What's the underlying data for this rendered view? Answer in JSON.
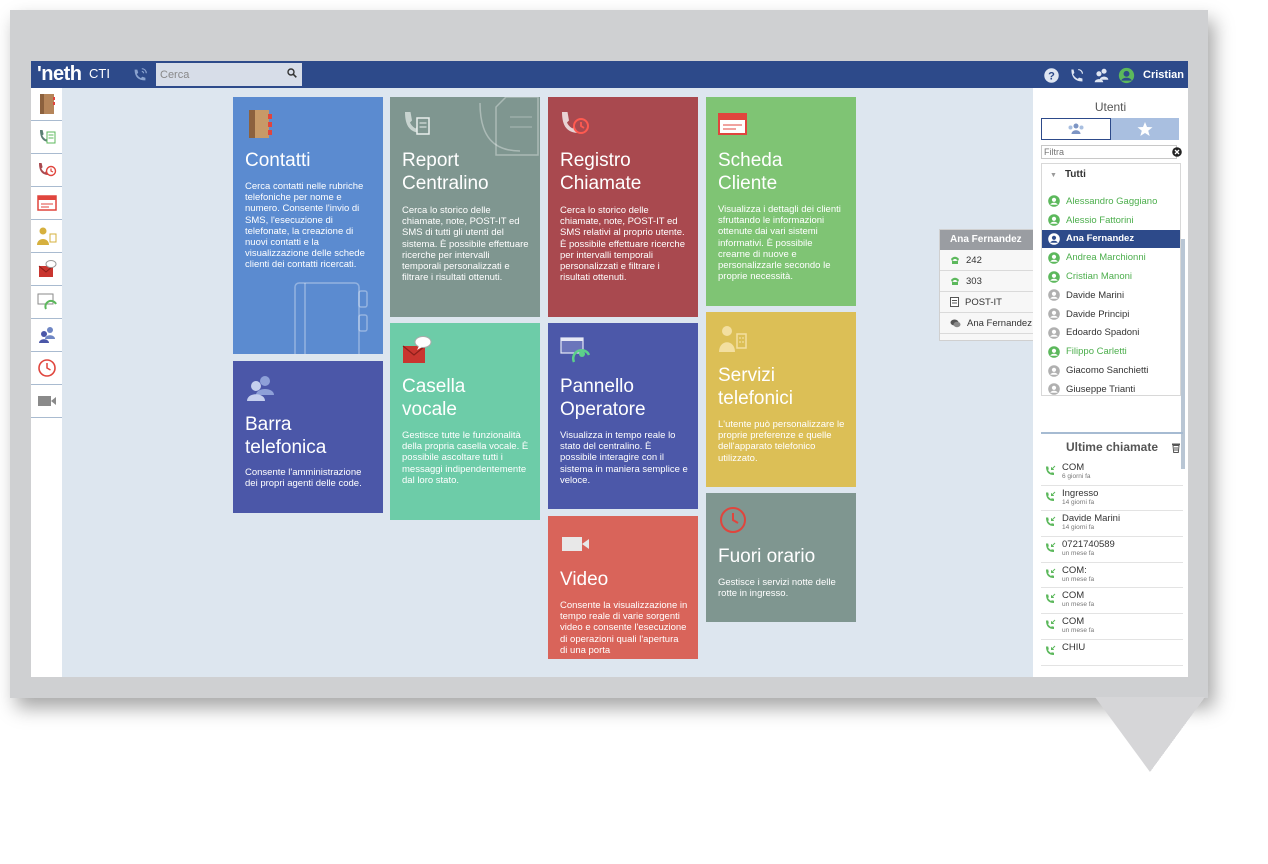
{
  "brand": {
    "logo": "'neth",
    "product": "CTI"
  },
  "search": {
    "placeholder": "Cerca"
  },
  "user": {
    "name": "Cristian"
  },
  "tiles": [
    {
      "key": "contatti",
      "title": "Contatti",
      "desc": "Cerca contatti nelle rubriche telefoniche per nome e numero. Consente l'invio di SMS, l'esecuzione di telefonate, la creazione di nuovi contatti e la visualizzazione delle schede clienti dei contatti ricercati.",
      "color": "#5b8bd0"
    },
    {
      "key": "barra",
      "title": "Barra telefonica",
      "desc": "Consente l'amministrazione dei propri agenti delle code.",
      "color": "#4b57a8"
    },
    {
      "key": "report",
      "title": "Report Centralino",
      "desc": "Cerca lo storico delle chiamate, note, POST-IT ed SMS di tutti gli utenti del sistema. È possibile effettuare ricerche per intervalli temporali personalizzati e filtrare i risultati ottenuti.",
      "color": "#7f9690"
    },
    {
      "key": "casella",
      "title": "Casella vocale",
      "desc": "Gestisce tutte le funzionalità della propria casella vocale. È possibile ascoltare tutti i messaggi indipendentemente dal loro stato.",
      "color": "#6dcca8"
    },
    {
      "key": "registro",
      "title": "Registro Chiamate",
      "desc": "Cerca lo storico delle chiamate, note, POST-IT ed SMS relativi al proprio utente. È possibile effettuare ricerche per intervalli temporali personalizzati e filtrare i risultati ottenuti.",
      "color": "#a9494f"
    },
    {
      "key": "pannello",
      "title": "Pannello Operatore",
      "desc": "Visualizza in tempo reale lo stato del centralino. È possibile interagire con il sistema in maniera semplice e veloce.",
      "color": "#4c58a9"
    },
    {
      "key": "video",
      "title": "Video",
      "desc": "Consente la visualizzazione in tempo reale di varie sorgenti video e consente l'esecuzione di operazioni quali l'apertura di una porta",
      "color": "#d9645a"
    },
    {
      "key": "scheda",
      "title": "Scheda Cliente",
      "desc": "Visualizza i dettagli dei clienti sfruttando le informazioni ottenute dai vari sistemi informativi. È possibile crearne di nuove e personalizzarle secondo le proprie necessità.",
      "color": "#7fc474"
    },
    {
      "key": "servizi",
      "title": "Servizi telefonici",
      "desc": "L'utente può personalizzare le proprie preferenze e quelle dell'apparato telefonico utilizzato.",
      "color": "#dcbf56"
    },
    {
      "key": "fuori",
      "title": "Fuori orario",
      "desc": "Gestisce i servizi notte delle rotte in ingresso.",
      "color": "#7f9690"
    }
  ],
  "users_panel": {
    "title": "Utenti",
    "filter_placeholder": "Filtra",
    "group": "Tutti",
    "users": [
      {
        "name": "Alessandro Gaggiano",
        "status": "online"
      },
      {
        "name": "Alessio Fattorini",
        "status": "online"
      },
      {
        "name": "Ana Fernandez",
        "status": "selected"
      },
      {
        "name": "Andrea Marchionni",
        "status": "online"
      },
      {
        "name": "Cristian Manoni",
        "status": "online"
      },
      {
        "name": "Davide Marini",
        "status": "offline"
      },
      {
        "name": "Davide Principi",
        "status": "offline"
      },
      {
        "name": "Edoardo Spadoni",
        "status": "offline"
      },
      {
        "name": "Filippo Carletti",
        "status": "online"
      },
      {
        "name": "Giacomo Sanchietti",
        "status": "offline"
      },
      {
        "name": "Giuseppe Trianti",
        "status": "offline"
      }
    ]
  },
  "popup": {
    "title": "Ana Fernandez",
    "rows": [
      "242",
      "303",
      "POST-IT",
      "Ana Fernandez"
    ]
  },
  "recent_calls": {
    "title": "Ultime chiamate",
    "items": [
      {
        "name": "COM",
        "time": "6 giorni fa"
      },
      {
        "name": "Ingresso",
        "time": "14 giorni fa"
      },
      {
        "name": "Davide Marini",
        "time": "14 giorni fa"
      },
      {
        "name": "0721740589",
        "time": "un mese fa"
      },
      {
        "name": "COM:",
        "time": "un mese fa"
      },
      {
        "name": "COM",
        "time": "un mese fa"
      },
      {
        "name": "COM",
        "time": "un mese fa"
      },
      {
        "name": "CHIU",
        "time": ""
      }
    ]
  },
  "colors": {
    "topbar": "#2d4a8a",
    "online": "#5cb85c",
    "offline": "#b0b0b0",
    "call": "#5cb85c"
  }
}
